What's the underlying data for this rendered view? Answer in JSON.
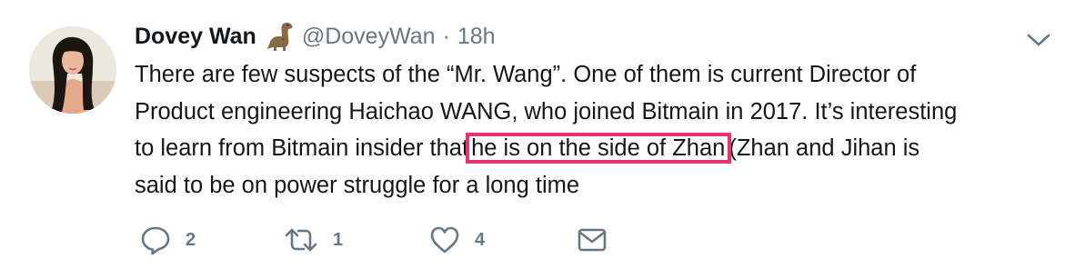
{
  "tweet": {
    "author_name": "Dovey Wan",
    "emoji_icon": "dinosaur-emoji",
    "handle": "@DoveyWan",
    "separator": "·",
    "time": "18h",
    "text": {
      "line1": "There are few suspects of the “Mr. Wang”. One of them is current Director of",
      "line2": "Product engineering Haichao WANG, who joined Bitmain in 2017. It’s interesting",
      "line3_before": "to learn from Bitmain insider that",
      "line3_highlight": "he is on the side of Zhan",
      "line3_after": "(Zhan and Jihan is",
      "line4": "said to be on power struggle for a long time"
    },
    "highlight_color": "#e8336d",
    "actions": {
      "reply_count": "2",
      "retweet_count": "1",
      "like_count": "4"
    }
  },
  "colors": {
    "text": "#14171a",
    "secondary": "#657786"
  }
}
